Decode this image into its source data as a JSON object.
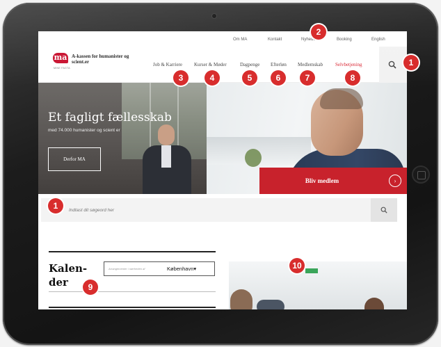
{
  "colors": {
    "brand_red": "#c8102e",
    "badge_red": "#d82d2d",
    "cta_red": "#c8222c"
  },
  "utility_nav": {
    "items": [
      "Om MA",
      "Kontakt",
      "Nyheder",
      "Booking",
      "English"
    ]
  },
  "logo": {
    "mark": "ma",
    "name": "A-kassen for humanister og scient.er",
    "tagline": "MINE FAGTA"
  },
  "main_nav": {
    "items": [
      "Job & Karriere",
      "Kurser & Møder",
      "Dagpenge",
      "Efterløn",
      "Medlemskab",
      "Selvbetjening"
    ]
  },
  "hero": {
    "title": "Et fagligt fællesskab",
    "subtitle": "med 74.000 humanister og scient er",
    "button": "Derfor MA",
    "cta": "Bliv medlem",
    "cta_icon": "arrow-right-icon"
  },
  "search": {
    "placeholder": "Indtast dit søgeord her",
    "icon": "search-icon"
  },
  "calendar": {
    "title": "Kalen-der",
    "select_hint": "Arrangementer i nærheden af",
    "select_value": "København"
  },
  "badges": [
    "1",
    "2",
    "3",
    "4",
    "5",
    "6",
    "7",
    "8",
    "1",
    "9",
    "10"
  ]
}
